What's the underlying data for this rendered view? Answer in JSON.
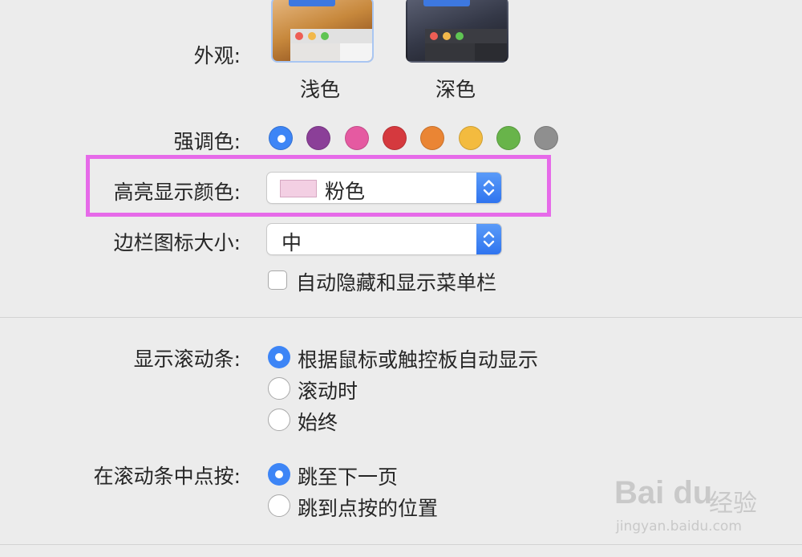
{
  "appearance": {
    "label": "外观:",
    "options": [
      {
        "label": "浅色",
        "selected": true
      },
      {
        "label": "深色",
        "selected": false
      }
    ]
  },
  "accent": {
    "label": "强调色:",
    "colors": [
      "#3d85f6",
      "#8b3f98",
      "#e55aa1",
      "#d5393e",
      "#ea8534",
      "#f3bb3f",
      "#68b44a",
      "#8f8f8f"
    ],
    "selected_index": 0
  },
  "highlight": {
    "label": "高亮显示颜色:",
    "value": "粉色",
    "chip_color": "#f3cfe3",
    "annotation_color": "#e66ae9"
  },
  "sidebar_icon_size": {
    "label": "边栏图标大小:",
    "value": "中"
  },
  "menubar": {
    "label": "自动隐藏和显示菜单栏",
    "checked": false
  },
  "show_scrollbars": {
    "label": "显示滚动条:",
    "options": [
      {
        "label": "根据鼠标或触控板自动显示",
        "selected": true
      },
      {
        "label": "滚动时",
        "selected": false
      },
      {
        "label": "始终",
        "selected": false
      }
    ]
  },
  "click_scrollbar": {
    "label": "在滚动条中点按:",
    "options": [
      {
        "label": "跳至下一页",
        "selected": true
      },
      {
        "label": "跳到点按的位置",
        "selected": false
      }
    ]
  },
  "watermark": {
    "logo": "Bai du",
    "text": "经验",
    "url": "jingyan.baidu.com"
  }
}
